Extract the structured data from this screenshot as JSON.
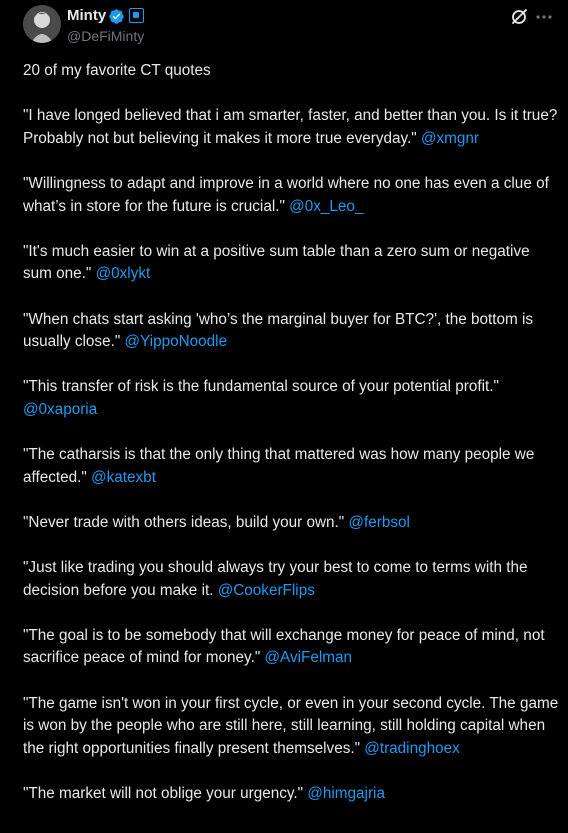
{
  "author": {
    "display_name": "Minty",
    "handle": "@DeFiMinty"
  },
  "icons": {
    "verified": "verified-badge-icon",
    "affiliate": "affiliate-badge-icon",
    "grok": "grok-icon",
    "more": "more-options-icon"
  },
  "colors": {
    "background": "#000000",
    "text": "#e7e9ea",
    "secondary_text": "#71767b",
    "link": "#1d9bf0"
  },
  "tweet": {
    "intro": "20 of my favorite CT quotes",
    "quotes": [
      {
        "text": "\"I have longed believed that i am smarter, faster, and better than you. Is it true? Probably not but believing it makes it more true everyday.\" ",
        "mention": "@xmgnr"
      },
      {
        "text": "\"Willingness to adapt and improve in a world where no one has even a clue of what’s in store for the future is crucial.\" ",
        "mention": "@0x_Leo_"
      },
      {
        "text": "\"It's much easier to win at a positive sum table than a zero sum or negative sum one.\" ",
        "mention": "@0xlykt"
      },
      {
        "text": "\"When chats start asking 'who’s the marginal buyer for BTC?', the bottom is usually close.\" ",
        "mention": "@YippoNoodle"
      },
      {
        "text": "\"This transfer of risk is the fundamental source of your potential profit.\" ",
        "mention": "@0xaporia"
      },
      {
        "text": "\"The catharsis is that the only thing that mattered was how many people we affected.\" ",
        "mention": "@katexbt"
      },
      {
        "text": "\"Never trade with others ideas, build your own.\" ",
        "mention": "@ferbsol"
      },
      {
        "text": "\"Just like trading you should always try your best to come to terms with the decision before you make it. ",
        "mention": "@CookerFlips"
      },
      {
        "text": "\"The goal is to be somebody that will exchange money for peace of mind, not sacrifice peace of mind for money.\" ",
        "mention": "@AviFelman"
      },
      {
        "text": "\"The game isn't won in your first cycle, or even in your second cycle. The game is won by the people who are still here, still learning, still holding capital when the right opportunities finally present themselves.\" ",
        "mention": "@tradinghoex"
      },
      {
        "text": "\"The market will not oblige your urgency.\" ",
        "mention": "@himgajria"
      }
    ]
  }
}
